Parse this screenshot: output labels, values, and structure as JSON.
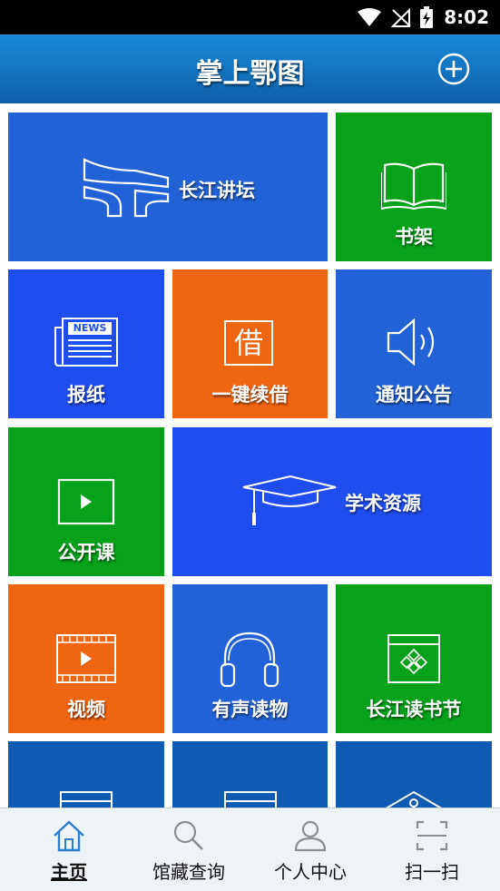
{
  "status": {
    "time": "8:02"
  },
  "app": {
    "title": "掌上鄂图"
  },
  "tiles": {
    "changjiang_forum": "长江讲坛",
    "bookshelf": "书架",
    "newspaper": "报纸",
    "newspaper_icon_text": "NEWS",
    "one_click_borrow": "一键续借",
    "borrow_icon_char": "借",
    "notices": "通知公告",
    "open_courses": "公开课",
    "academic_resources": "学术资源",
    "video": "视频",
    "audio_books": "有声读物",
    "reading_festival": "长江读书节"
  },
  "nav": {
    "home": "主页",
    "catalog_search": "馆藏查询",
    "personal_center": "个人中心",
    "scan": "扫一扫"
  },
  "colors": {
    "status_bar": "#000000",
    "app_bar_top": "#1a8ad8",
    "app_bar_bottom": "#0e5fa8",
    "tile_blue": "#2163d6",
    "tile_green": "#08a11a",
    "tile_orange": "#f06511",
    "tile_royal": "#1f4ef0",
    "tile_deep": "#0f5bb1",
    "nav_active": "#2a7fd4",
    "nav_inactive": "#8a8f94"
  }
}
